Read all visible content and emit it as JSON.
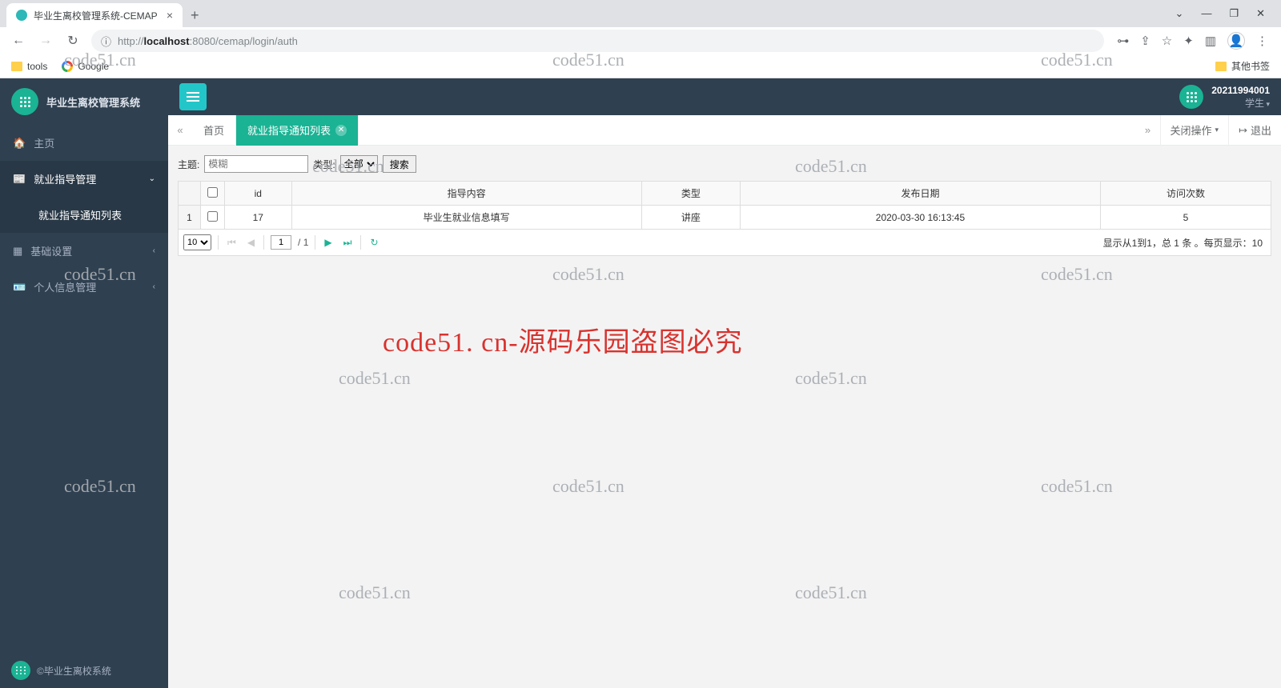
{
  "browser": {
    "tab_title": "毕业生离校管理系统-CEMAP",
    "url_prefix": "http://",
    "url_host": "localhost",
    "url_port": ":8080",
    "url_path": "/cemap/login/auth",
    "bookmarks": {
      "tools": "tools",
      "google": "Google",
      "other": "其他书签"
    }
  },
  "app": {
    "title": "毕业生离校管理系统",
    "footer": "©毕业生离校系统",
    "user_id": "20211994001",
    "user_role": "学生"
  },
  "menu": {
    "home": "主页",
    "guide": "就业指导管理",
    "guide_list": "就业指导通知列表",
    "basic": "基础设置",
    "personal": "个人信息管理"
  },
  "tabs": {
    "home": "首页",
    "active": "就业指导通知列表",
    "close_ops": "关闭操作",
    "logout": "退出"
  },
  "search": {
    "subject_label": "主题:",
    "subject_placeholder": "模糊",
    "type_label": "类型:",
    "type_option": "全部",
    "search_btn": "搜索"
  },
  "table": {
    "headers": {
      "id": "id",
      "content": "指导内容",
      "type": "类型",
      "date": "发布日期",
      "visits": "访问次数"
    },
    "row": {
      "num": "1",
      "id": "17",
      "content": "毕业生就业信息填写",
      "type": "讲座",
      "date": "2020-03-30 16:13:45",
      "visits": "5"
    }
  },
  "pager": {
    "page_size": "10",
    "current": "1",
    "total_pages": "/ 1",
    "info": "显示从1到1，总 1 条 。每页显示：10"
  },
  "watermarks": {
    "small": "code51.cn",
    "big": "code51. cn-源码乐园盗图必究"
  }
}
